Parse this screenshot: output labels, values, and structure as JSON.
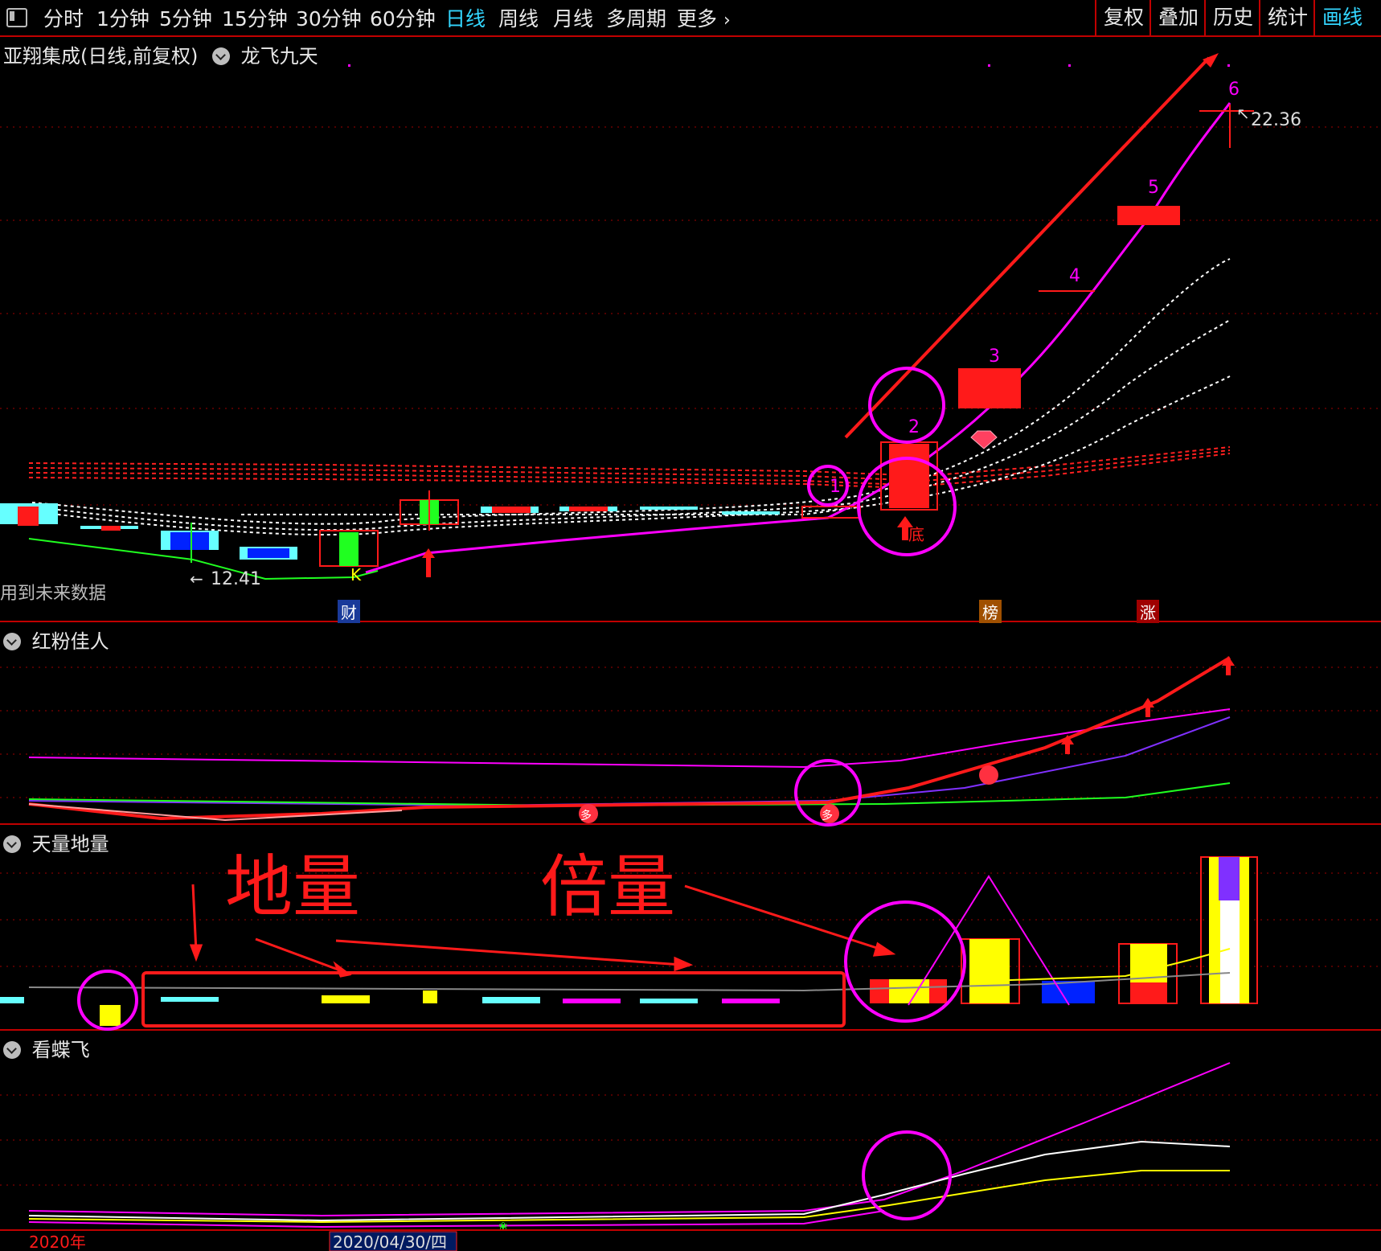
{
  "toolbar": {
    "periods": [
      "分时",
      "1分钟",
      "5分钟",
      "15分钟",
      "30分钟",
      "60分钟",
      "日线",
      "周线",
      "月线",
      "多周期"
    ],
    "more_label": "更多",
    "active_period": "日线",
    "right_buttons": [
      "复权",
      "叠加",
      "历史",
      "统计",
      "画线"
    ],
    "active_right": "画线"
  },
  "main_panel": {
    "title": "亚翔集成(日线,前复权)",
    "indicator": "龙飞九天",
    "future_data_note": "用到未来数据",
    "price_high_label": "22.36",
    "price_low_label": "12.41",
    "wave_labels": [
      "1",
      "2",
      "3",
      "4",
      "5",
      "6"
    ],
    "k_label": "K",
    "di_label": "底",
    "bottom_tags": {
      "cai": "财",
      "bang": "榜",
      "zhang": "涨"
    }
  },
  "panel2": {
    "title": "红粉佳人",
    "marker_text": "多"
  },
  "panel3": {
    "title": "天量地量",
    "annotation_left": "地量",
    "annotation_right": "倍量"
  },
  "panel4": {
    "title": "看蝶飞"
  },
  "footer": {
    "year_label": "2020年",
    "date_label": "2020/04/30/四"
  },
  "colors": {
    "border": "#c00000",
    "grid": "#a00000",
    "accent": "#33d6ff",
    "magenta": "#ff00ff",
    "red": "#ff1a1a",
    "yellow": "#ffff00",
    "cyan": "#66ffff",
    "green": "#00ff00",
    "blue": "#0022ff"
  }
}
